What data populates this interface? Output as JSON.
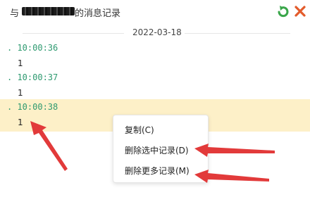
{
  "header": {
    "title_prefix": "与",
    "title_suffix": "的消息记录",
    "refresh_icon": "refresh-icon",
    "close_icon": "close-icon",
    "accent_green": "#2e9a70",
    "close_color": "#e35b2b"
  },
  "date_separator": "2022-03-18",
  "messages": [
    {
      "time": ". 10:00:36",
      "text": "1"
    },
    {
      "time": ". 10:00:37",
      "text": "1"
    },
    {
      "time": ". 10:00:38",
      "text": "1"
    }
  ],
  "selected_message_index": 2,
  "context_menu": {
    "items": [
      "复制(C)",
      "删除选中记录(D)",
      "删除更多记录(M)"
    ]
  },
  "annotation_color": "#e23a3a"
}
